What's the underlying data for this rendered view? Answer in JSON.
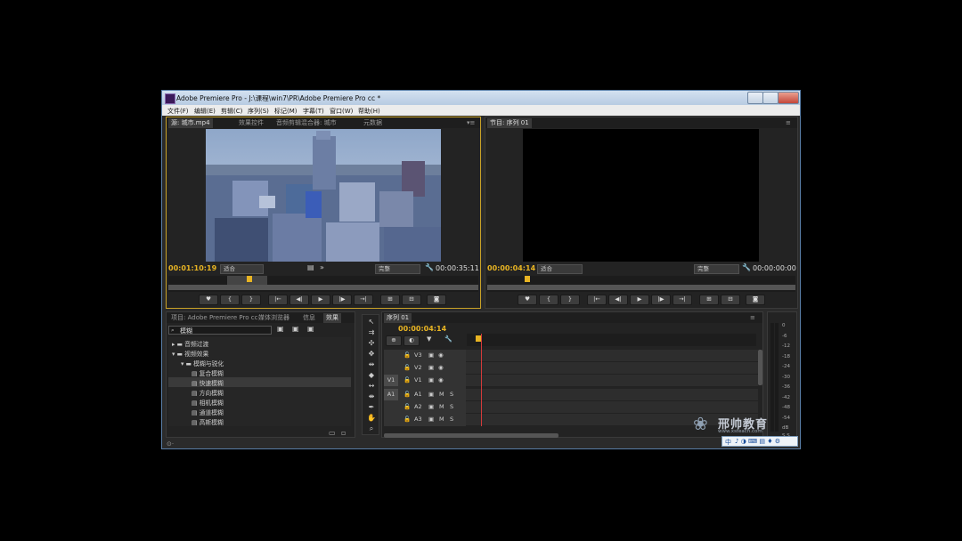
{
  "window": {
    "title": "Adobe Premiere Pro - J:\\课程\\win7\\PR\\Adobe Premiere Pro cc *"
  },
  "menu": [
    "文件(F)",
    "编辑(E)",
    "剪辑(C)",
    "序列(S)",
    "标记(M)",
    "字幕(T)",
    "窗口(W)",
    "帮助(H)"
  ],
  "source": {
    "tabs": [
      "源: 城市.mp4",
      "效果控件",
      "音频剪辑混合器: 城市",
      "元数据"
    ],
    "timecode_in": "00:01:10:19",
    "fit": "适合",
    "quality": "完整",
    "duration": "00:00:35:11"
  },
  "program": {
    "tab": "节目: 序列 01",
    "timecode": "00:00:04:14",
    "fit": "适合",
    "quality": "完整",
    "duration": "00:00:00:00"
  },
  "transport_buttons": [
    "♥",
    "{",
    "}",
    "|←",
    "◀|",
    "▶",
    "|▶",
    "→|",
    "⊞",
    "⊟",
    "◙"
  ],
  "project": {
    "tabs": [
      "项目: Adobe Premiere Pro cc",
      "媒体浏览器",
      "信息",
      "效果"
    ],
    "search": "模糊",
    "tree": [
      {
        "label": "音频过渡",
        "level": 0,
        "expanded": false
      },
      {
        "label": "视频效果",
        "level": 0,
        "expanded": true
      },
      {
        "label": "模糊与锐化",
        "level": 1,
        "expanded": true
      },
      {
        "label": "复合模糊",
        "level": 2
      },
      {
        "label": "快速模糊",
        "level": 2,
        "selected": true
      },
      {
        "label": "方向模糊",
        "level": 2
      },
      {
        "label": "相机模糊",
        "level": 2
      },
      {
        "label": "通道模糊",
        "level": 2
      },
      {
        "label": "高斯模糊",
        "level": 2
      }
    ]
  },
  "sequence": {
    "tab": "序列 01",
    "timecode": "00:00:04:14",
    "tracks": [
      {
        "src": "",
        "name": "V3",
        "kind": "video"
      },
      {
        "src": "",
        "name": "V2",
        "kind": "video"
      },
      {
        "src": "V1",
        "name": "V1",
        "kind": "video"
      },
      {
        "src": "A1",
        "name": "A1",
        "kind": "audio"
      },
      {
        "src": "",
        "name": "A2",
        "kind": "audio"
      },
      {
        "src": "",
        "name": "A3",
        "kind": "audio"
      }
    ]
  },
  "meter_labels": [
    "0",
    "-6",
    "-12",
    "-18",
    "-24",
    "-30",
    "-36",
    "-42",
    "-48",
    "-54",
    "dB"
  ],
  "meter_footer": "S S",
  "watermark": {
    "brand": "邢帅教育",
    "url": "www.xsteach.com"
  },
  "ime": "中",
  "accent_color": "#e8b423",
  "playhead_color": "#d43a3a"
}
